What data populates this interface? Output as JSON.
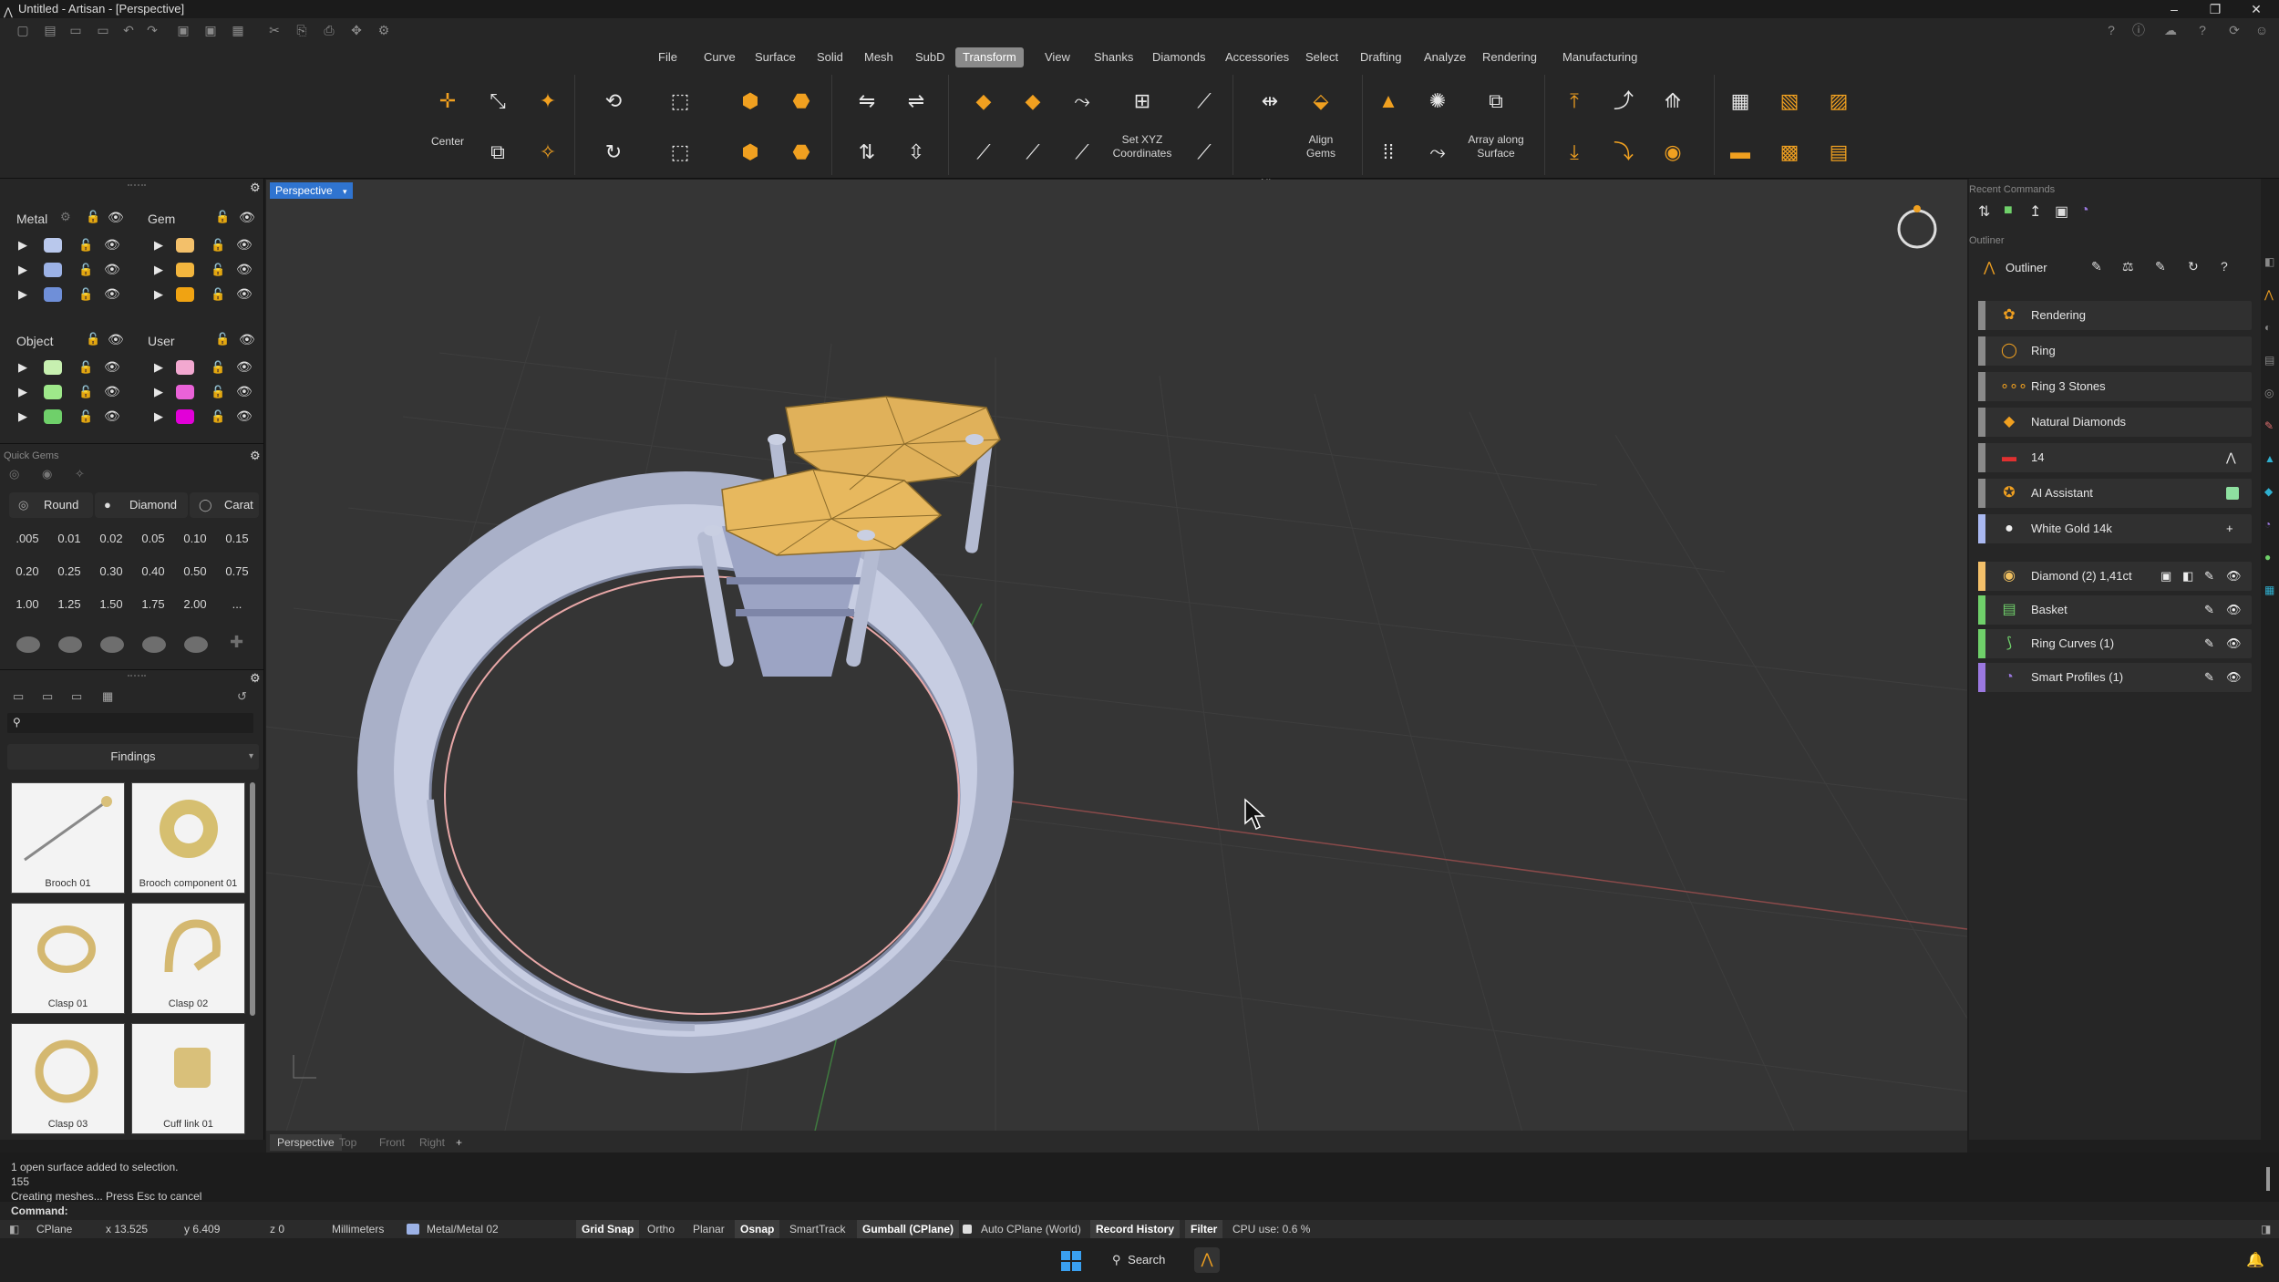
{
  "window": {
    "title": "Untitled - Artisan - [Perspective]"
  },
  "menu": [
    "File",
    "Curve",
    "Surface",
    "Solid",
    "Mesh",
    "SubD",
    "Transform",
    "View",
    "Shanks",
    "Diamonds",
    "Accessories",
    "Select",
    "Drafting",
    "Analyze",
    "Rendering",
    "Manufacturing"
  ],
  "menu_active": "Transform",
  "ribbon": {
    "center": "Center",
    "set_xyz": "Set XYZ Coordinates",
    "align": "Align",
    "align_gems": "Align Gems",
    "array_surface": "Array along Surface"
  },
  "layers": {
    "metal": "Metal",
    "gem": "Gem",
    "object": "Object",
    "user": "User",
    "metal_colors": [
      "#b9c8ec",
      "#9cb2e6",
      "#6f8fd8"
    ],
    "gem_colors": [
      "#f3c06a",
      "#f3b63e",
      "#f0a312"
    ],
    "object_colors": [
      "#c7f0b0",
      "#9ee88a",
      "#6fd06a"
    ],
    "user_colors": [
      "#f2a8d0",
      "#ea62d8",
      "#e200d8"
    ]
  },
  "quick_gems": {
    "title": "Quick Gems",
    "shape": "Round",
    "type": "Diamond",
    "unit": "Carat",
    "sizes": [
      ".005",
      "0.01",
      "0.02",
      "0.05",
      "0.10",
      "0.15",
      "0.20",
      "0.25",
      "0.30",
      "0.40",
      "0.50",
      "0.75",
      "1.00",
      "1.25",
      "1.50",
      "1.75",
      "2.00",
      "..."
    ]
  },
  "library": {
    "category": "Findings",
    "items": [
      "Brooch 01",
      "Brooch component 01",
      "Clasp 01",
      "Clasp 02",
      "Clasp 03",
      "Cuff link 01"
    ]
  },
  "viewport": {
    "active": "Perspective",
    "tabs": [
      "Perspective",
      "Top",
      "Front",
      "Right"
    ],
    "add_tab": "+"
  },
  "right": {
    "recent_title": "Recent Commands",
    "outliner_title": "Outliner",
    "outliner_tab": "Outliner",
    "items": [
      {
        "label": "Rendering",
        "bar": "#8a8a8a",
        "icon": "palette-icon"
      },
      {
        "label": "Ring",
        "bar": "#8a8a8a",
        "icon": "ring-icon"
      },
      {
        "label": "Ring 3 Stones",
        "bar": "#8a8a8a",
        "icon": "three-stones-icon"
      },
      {
        "label": "Natural Diamonds",
        "bar": "#8a8a8a",
        "icon": "diamond-icon"
      },
      {
        "label": "14",
        "bar": "#8a8a8a",
        "icon": "flag-icon"
      },
      {
        "label": "AI Assistant",
        "bar": "#8a8a8a",
        "icon": "ai-icon"
      },
      {
        "label": "White Gold 14k",
        "bar": "#a9b8f0",
        "icon": "material-icon"
      }
    ],
    "objects": [
      {
        "label": "Diamond (2) 1,41ct",
        "bar": "#f3c06a",
        "icon": "gem-material-icon"
      },
      {
        "label": "Basket",
        "bar": "#6fd06a",
        "icon": "basket-icon"
      },
      {
        "label": "Ring Curves (1)",
        "bar": "#6fd06a",
        "icon": "curve-icon"
      },
      {
        "label": "Smart Profiles (1)",
        "bar": "#9b78e0",
        "icon": "profile-icon"
      }
    ]
  },
  "console": {
    "lines": [
      "1 open surface added to selection.",
      "155",
      "Creating meshes... Press Esc to cancel"
    ],
    "prompt": "Command:"
  },
  "status": {
    "cplane": "CPlane",
    "x": "x 13.525",
    "y": "y 6.409",
    "z": "z 0",
    "units": "Millimeters",
    "layer": "Metal/Metal 02",
    "grid_snap": "Grid Snap",
    "ortho": "Ortho",
    "planar": "Planar",
    "osnap": "Osnap",
    "smarttrack": "SmartTrack",
    "gumball": "Gumball (CPlane)",
    "auto_cplane": "Auto CPlane (World)",
    "record_history": "Record History",
    "filter": "Filter",
    "cpu": "CPU use: 0.6 %"
  },
  "taskbar": {
    "search": "Search"
  }
}
